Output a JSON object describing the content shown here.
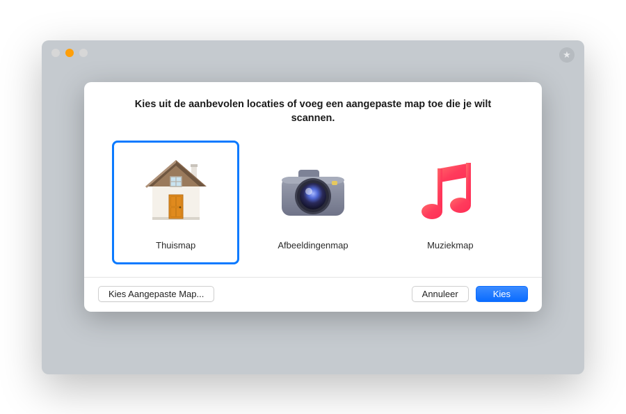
{
  "window": {
    "traffic_lights": {
      "close": "close",
      "minimize": "minimize",
      "maximize": "maximize"
    },
    "star_glyph": "★"
  },
  "sheet": {
    "title": "Kies uit de aanbevolen locaties of voeg een aangepaste map toe die je wilt scannen.",
    "options": [
      {
        "key": "home",
        "label": "Thuismap",
        "icon": "home-folder-icon",
        "selected": true
      },
      {
        "key": "pictures",
        "label": "Afbeeldingenmap",
        "icon": "camera-icon",
        "selected": false
      },
      {
        "key": "music",
        "label": "Muziekmap",
        "icon": "music-icon",
        "selected": false
      }
    ],
    "buttons": {
      "custom": "Kies Aangepaste Map...",
      "cancel": "Annuleer",
      "choose": "Kies"
    }
  },
  "colors": {
    "selection": "#0a7aff",
    "primary_button": "#0a6cff"
  }
}
